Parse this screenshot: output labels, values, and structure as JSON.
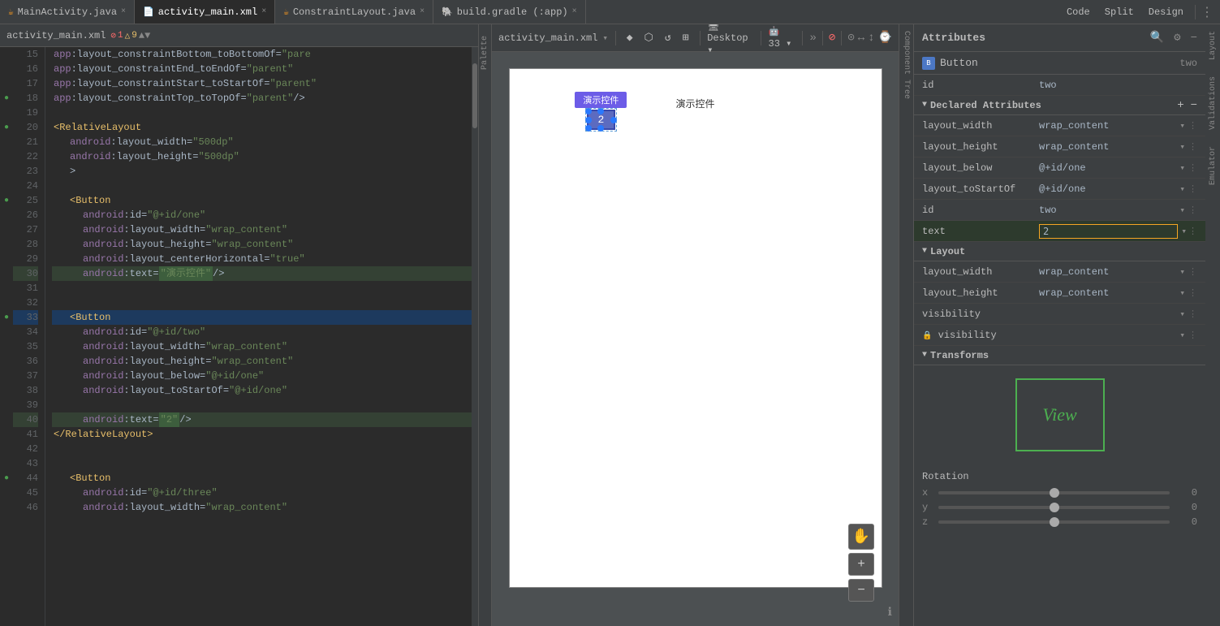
{
  "tabs": [
    {
      "id": "main-activity",
      "label": "MainActivity.java",
      "type": "java",
      "active": false,
      "icon": "☕"
    },
    {
      "id": "activity-main-xml",
      "label": "activity_main.xml",
      "type": "xml",
      "active": true,
      "icon": "📄"
    },
    {
      "id": "constraint-layout",
      "label": "ConstraintLayout.java",
      "type": "java",
      "active": false,
      "icon": "☕"
    },
    {
      "id": "build-gradle",
      "label": "build.gradle (:app)",
      "type": "gradle",
      "active": false,
      "icon": "🐘"
    }
  ],
  "top_toolbar": {
    "code_label": "Code",
    "split_label": "Split",
    "design_label": "Design"
  },
  "editor": {
    "filename": "activity_main.xml",
    "error_count": "1",
    "warning_count": "9",
    "lines": [
      {
        "num": "15",
        "content": "    app:layout_constraintBottom_toBottomOf=\"pare",
        "highlight": false,
        "gutter": ""
      },
      {
        "num": "16",
        "content": "    app:layout_constraintEnd_toEndOf=\"parent\"",
        "highlight": false,
        "gutter": ""
      },
      {
        "num": "17",
        "content": "    app:layout_constraintStart_toStartOf=\"parent\"",
        "highlight": false,
        "gutter": ""
      },
      {
        "num": "18",
        "content": "    app:layout_constraintTop_toTopOf=\"parent\" />",
        "highlight": false,
        "gutter": "dot"
      },
      {
        "num": "19",
        "content": "",
        "highlight": false,
        "gutter": ""
      },
      {
        "num": "20",
        "content": "<RelativeLayout",
        "highlight": false,
        "gutter": "dot"
      },
      {
        "num": "21",
        "content": "    android:layout_width=\"500dp\"",
        "highlight": false,
        "gutter": ""
      },
      {
        "num": "22",
        "content": "    android:layout_height=\"500dp\"",
        "highlight": false,
        "gutter": ""
      },
      {
        "num": "23",
        "content": "    >",
        "highlight": false,
        "gutter": ""
      },
      {
        "num": "24",
        "content": "",
        "highlight": false,
        "gutter": ""
      },
      {
        "num": "25",
        "content": "    <Button",
        "highlight": false,
        "gutter": "dot"
      },
      {
        "num": "26",
        "content": "        android:id=\"@+id/one\"",
        "highlight": false,
        "gutter": ""
      },
      {
        "num": "27",
        "content": "        android:layout_width=\"wrap_content\"",
        "highlight": false,
        "gutter": ""
      },
      {
        "num": "28",
        "content": "        android:layout_height=\"wrap_content\"",
        "highlight": false,
        "gutter": ""
      },
      {
        "num": "29",
        "content": "        android:layout_centerHorizontal=\"true\"",
        "highlight": false,
        "gutter": ""
      },
      {
        "num": "30",
        "content": "        android:text=\"演示控件\" />",
        "highlight": true,
        "gutter": ""
      },
      {
        "num": "31",
        "content": "",
        "highlight": false,
        "gutter": ""
      },
      {
        "num": "32",
        "content": "",
        "highlight": false,
        "gutter": ""
      },
      {
        "num": "33",
        "content": "    <Button",
        "highlight": false,
        "gutter": "dot",
        "selected": true
      },
      {
        "num": "34",
        "content": "        android:id=\"@+id/two\"",
        "highlight": false,
        "gutter": ""
      },
      {
        "num": "35",
        "content": "        android:layout_width=\"wrap_content\"",
        "highlight": false,
        "gutter": ""
      },
      {
        "num": "36",
        "content": "        android:layout_height=\"wrap_content\"",
        "highlight": false,
        "gutter": ""
      },
      {
        "num": "37",
        "content": "        android:layout_below=\"@+id/one\"",
        "highlight": false,
        "gutter": ""
      },
      {
        "num": "38",
        "content": "        android:layout_toStartOf=\"@+id/one\"",
        "highlight": false,
        "gutter": ""
      },
      {
        "num": "39",
        "content": "",
        "highlight": false,
        "gutter": ""
      },
      {
        "num": "40",
        "content": "        android:text=\"2\" />",
        "highlight": true,
        "gutter": ""
      },
      {
        "num": "41",
        "content": "    </RelativeLayout>",
        "highlight": false,
        "gutter": ""
      },
      {
        "num": "42",
        "content": "",
        "highlight": false,
        "gutter": ""
      },
      {
        "num": "43",
        "content": "",
        "highlight": false,
        "gutter": ""
      },
      {
        "num": "44",
        "content": "    <Button",
        "highlight": false,
        "gutter": "dot"
      },
      {
        "num": "45",
        "content": "        android:id=\"@+id/three\"",
        "highlight": false,
        "gutter": ""
      },
      {
        "num": "46",
        "content": "        android:layout_width=\"wrap_content\"",
        "highlight": false,
        "gutter": ""
      }
    ]
  },
  "design_toolbar": {
    "filename_label": "activity_main.xml",
    "device_label": "Desktop",
    "api_label": "33",
    "zoom_tooltip": "Zoom"
  },
  "canvas": {
    "button1_text": "演示控件",
    "button2_text": "2"
  },
  "attributes": {
    "title": "Attributes",
    "component": "Button",
    "component_id": "two",
    "rows": [
      {
        "label": "id",
        "value": "two",
        "type": "text"
      },
      {
        "label": "layout_width",
        "value": "wrap_content",
        "type": "dropdown"
      },
      {
        "label": "layout_height",
        "value": "wrap_content",
        "type": "dropdown"
      },
      {
        "label": "layout_below",
        "value": "@+id/one",
        "type": "dropdown"
      },
      {
        "label": "layout_toStartOf",
        "value": "@+id/one",
        "type": "dropdown"
      },
      {
        "label": "id",
        "value": "two",
        "type": "text"
      },
      {
        "label": "text",
        "value": "2",
        "type": "input_highlighted"
      }
    ],
    "layout_section": {
      "title": "Layout",
      "rows": [
        {
          "label": "layout_width",
          "value": "wrap_content",
          "type": "dropdown"
        },
        {
          "label": "layout_height",
          "value": "wrap_content",
          "type": "dropdown"
        },
        {
          "label": "visibility",
          "value": "",
          "type": "dropdown"
        },
        {
          "label": "visibility",
          "value": "",
          "type": "dropdown_lock"
        }
      ]
    },
    "transforms_section": {
      "title": "Transforms"
    },
    "view_label": "View",
    "rotation": {
      "title": "Rotation",
      "x_value": "0",
      "y_value": "0",
      "z_value": "0"
    }
  },
  "right_side_labels": [
    "Layout",
    "Validations",
    "Emulator"
  ],
  "component_tree_label": "Component Tree",
  "palette_label": "Palette"
}
